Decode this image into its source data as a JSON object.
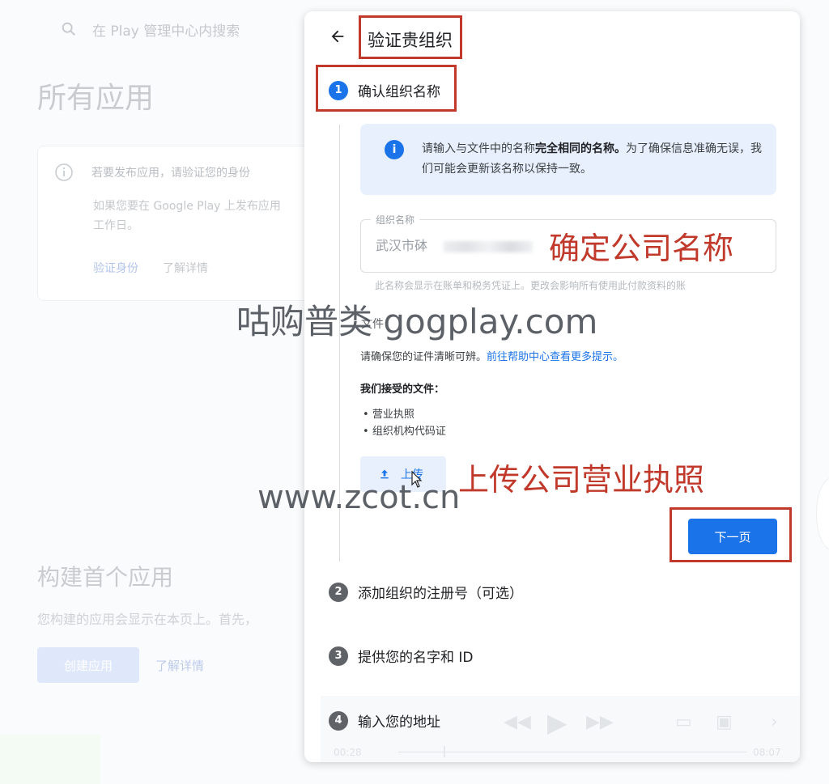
{
  "background": {
    "search_placeholder": "在 Play 管理中心内搜索",
    "page_title": "所有应用",
    "notice_title": "若要发布应用，请验证您的身份",
    "notice_body": "如果您要在 Google Play 上发布应用",
    "notice_body_2": "工作日。",
    "notice_link_verify": "验证身份",
    "notice_link_learn": "了解详情",
    "build_title": "构建首个应用",
    "build_desc": "您构建的应用会显示在本页上。首先，",
    "create_button": "创建应用",
    "build_learn": "了解详情"
  },
  "dialog": {
    "title": "验证贵组织",
    "steps": [
      {
        "number": "1",
        "label": "确认组织名称"
      },
      {
        "number": "2",
        "label": "添加组织的注册号（可选）"
      },
      {
        "number": "3",
        "label": "提供您的名字和 ID"
      },
      {
        "number": "4",
        "label": "输入您的地址"
      }
    ],
    "info_text_1": "请输入与文件中的名称",
    "info_text_bold": "完全相同的名称。",
    "info_text_2": "为了确保信息准确无误，我们可能会更新该名称以保持一致。",
    "field_label": "组织名称",
    "field_value": "武汉市砵",
    "field_hint": "此名称会显示在账单和税务凭证上。更改会影响所有使用此付款资料的账",
    "doc_label": "文件",
    "doc_desc": "请确保您的证件清晰可辨。",
    "doc_link": "前往帮助中心查看更多提示。",
    "accepted_title": "我们接受的文件：",
    "accepted_docs": [
      "营业执照",
      "组织机构代码证"
    ],
    "upload_label": "上传",
    "next_button": "下一页"
  },
  "video": {
    "time_current": "00:28",
    "time_total": "08:07",
    "progress": 0.13
  },
  "annotations": {
    "confirm_name": "确定公司名称",
    "upload_license": "上传公司营业执照"
  },
  "watermarks": {
    "line1": "咕购普类 gogplay.com",
    "line2": "www.zcot.cn"
  },
  "colors": {
    "primary": "#1a73e8",
    "annotation_red": "#c0392b",
    "info_bg": "#e8f0fe"
  }
}
